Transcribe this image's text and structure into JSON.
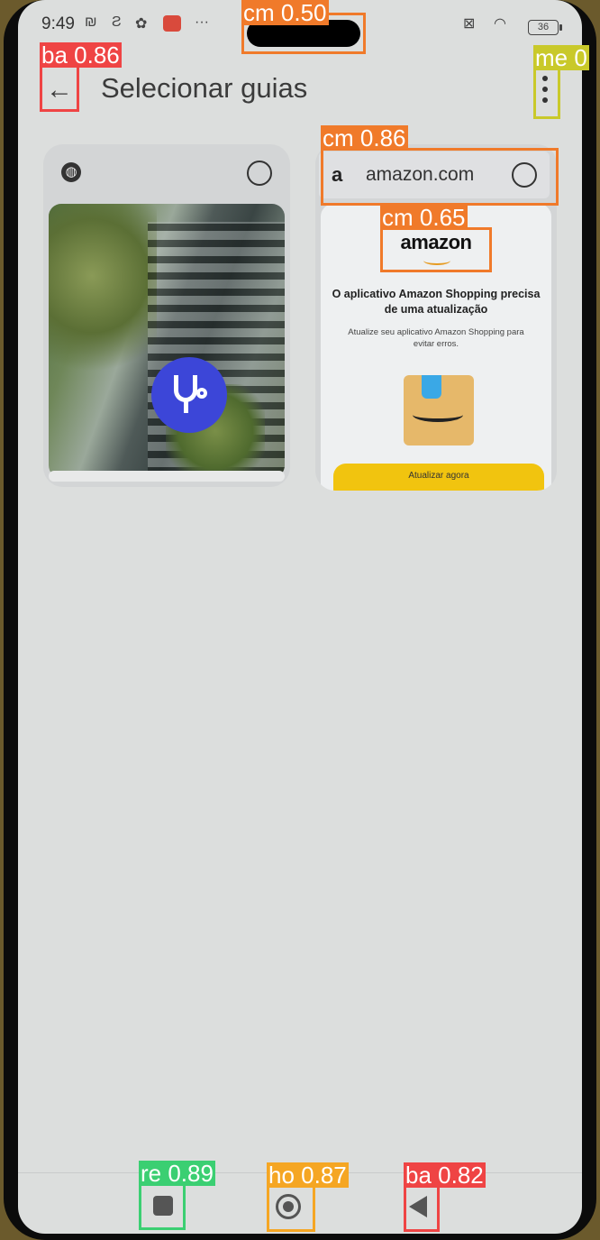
{
  "status_bar": {
    "time": "9:49",
    "icons": [
      "nfc-icon",
      "s-app-icon",
      "settings-icon",
      "mail-icon",
      "more-icon"
    ],
    "battery": "36"
  },
  "app_bar": {
    "title": "Selecionar guias"
  },
  "tabs": [
    {
      "favicon": "globe-icon",
      "thumbnail": "health-app-icon"
    },
    {
      "favicon": "a",
      "url": "amazon.com",
      "page": {
        "logo": "amazon",
        "message": "O aplicativo Amazon Shopping precisa de uma atualização",
        "sub": "Atualize seu aplicativo Amazon Shopping para evitar erros.",
        "button": "Atualizar agora"
      }
    }
  ],
  "nav_bar": {
    "icons": [
      "recents-icon",
      "home-icon",
      "back-icon"
    ]
  },
  "detections": [
    {
      "label": "cm 0.50",
      "color": "#f07a2a"
    },
    {
      "label": "ba 0.86",
      "color": "#ef4444"
    },
    {
      "label": "me 0",
      "color": "#c9c92a"
    },
    {
      "label": "cm 0.86",
      "color": "#f07a2a"
    },
    {
      "label": "cm 0.65",
      "color": "#f07a2a"
    },
    {
      "label": "re 0.89",
      "color": "#3bcf72"
    },
    {
      "label": "ho 0.87",
      "color": "#f5a623"
    },
    {
      "label": "ba 0.82",
      "color": "#ef4444"
    }
  ]
}
